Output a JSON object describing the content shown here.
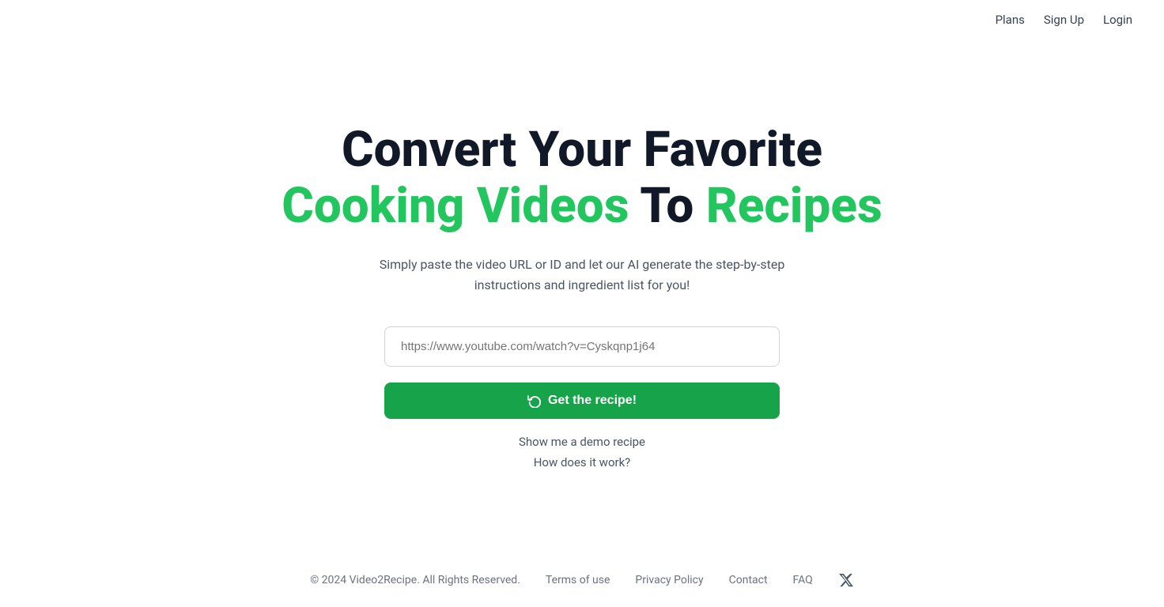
{
  "nav": {
    "plans_label": "Plans",
    "signup_label": "Sign Up",
    "login_label": "Login"
  },
  "hero": {
    "title_line1": "Convert Your Favorite",
    "title_line2_word1": "Cooking",
    "title_line2_word2": "Videos",
    "title_line2_word3": "To",
    "title_line2_word4": "Recipes",
    "subtitle": "Simply paste the video URL or ID and let our AI generate the step-by-step instructions and ingredient list for you!",
    "input_placeholder": "https://www.youtube.com/watch?v=Cyskqnp1j64",
    "cta_button_label": "Get the recipe!",
    "demo_link_label": "Show me a demo recipe",
    "how_link_label": "How does it work?"
  },
  "footer": {
    "copyright": "© 2024 Video2Recipe. All Rights Reserved.",
    "terms_label": "Terms of use",
    "privacy_label": "Privacy Policy",
    "contact_label": "Contact",
    "faq_label": "FAQ"
  },
  "colors": {
    "green": "#22c55e",
    "dark_green": "#16a34a",
    "dark": "#111827",
    "gray": "#4b5563",
    "light_gray": "#6b7280"
  }
}
